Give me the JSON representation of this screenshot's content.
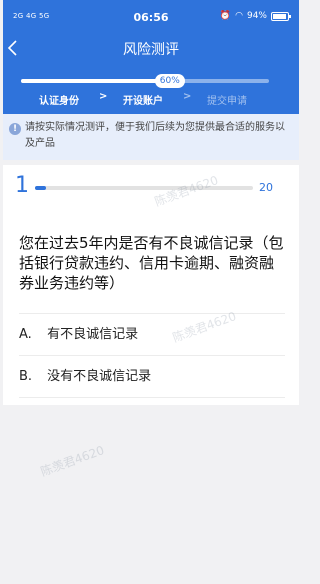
{
  "status_bar": {
    "left_text": "2G 4G 5G",
    "time": "06:56",
    "battery": "94%",
    "battery_level": 0.94
  },
  "nav": {
    "title": "风险测评",
    "back_icon": "chevron-left-icon"
  },
  "progress": {
    "label": "60%",
    "fraction": 0.6
  },
  "steps": [
    {
      "label": "认证身份",
      "state": "active"
    },
    {
      "label": "开设账户",
      "state": "active"
    },
    {
      "label": "提交申请",
      "state": "inactive"
    }
  ],
  "step_separator": ">",
  "notice": {
    "icon": "info-icon",
    "icon_glyph": "!",
    "text": "请按实际情况测评，便于我们后续为您提供最合适的服务以及产品"
  },
  "question": {
    "number": "1",
    "total": "20",
    "progress_fraction": 0.05,
    "text": "您在过去5年内是否有不良诚信记录（包括银行贷款违约、信用卡逾期、融资融券业务违约等）",
    "options": [
      {
        "key": "A.",
        "label": "有不良诚信记录"
      },
      {
        "key": "B.",
        "label": "没有不良诚信记录"
      }
    ]
  },
  "watermark": {
    "text": "陈羡君4620"
  },
  "colors": {
    "primary": "#2f73db",
    "notice_bg": "#e7eefb",
    "page_bg": "#f1f1f3"
  }
}
